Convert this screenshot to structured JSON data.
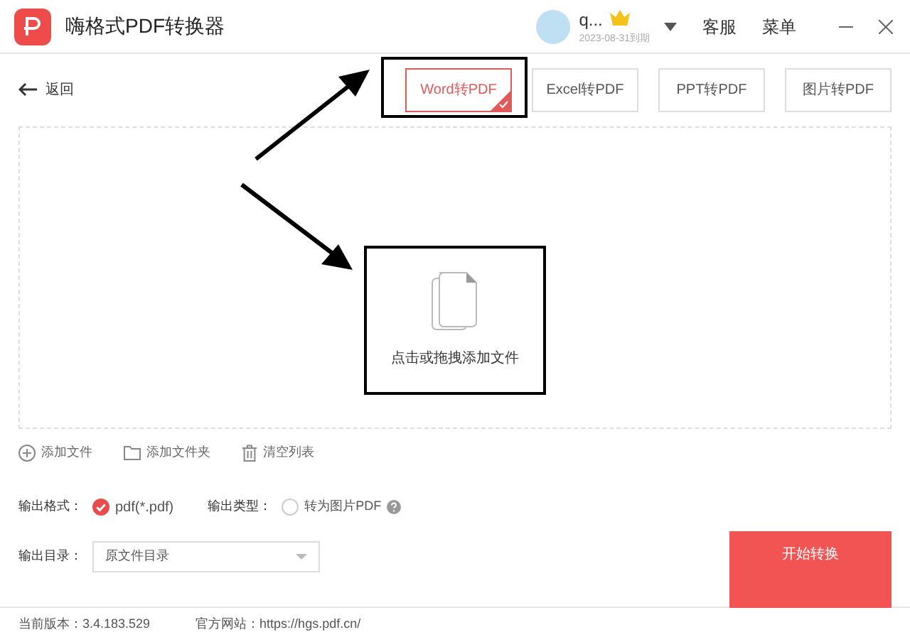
{
  "window": {
    "title": "嗨格式PDF转换器"
  },
  "account": {
    "name": "q...",
    "expiry": "2023-08-31到期"
  },
  "header_links": [
    "客服",
    "菜单"
  ],
  "back": "返回",
  "tabs": [
    {
      "label": "Word转PDF",
      "selected": true
    },
    {
      "label": "Excel转PDF",
      "selected": false
    },
    {
      "label": "PPT转PDF",
      "selected": false
    },
    {
      "label": "图片转PDF",
      "selected": false
    }
  ],
  "dropzone": {
    "hint": "点击或拖拽添加文件"
  },
  "actions": [
    {
      "kind": "add-file",
      "label": "添加文件"
    },
    {
      "kind": "add-folder",
      "label": "添加文件夹"
    },
    {
      "kind": "clear",
      "label": "清空列表"
    }
  ],
  "output_format": {
    "label": "输出格式：",
    "option": {
      "label": "pdf(*.pdf)",
      "checked": true
    }
  },
  "output_type": {
    "label": "输出类型：",
    "option": {
      "label": "转为图片PDF",
      "checked": false
    }
  },
  "output_dir": {
    "label": "输出目录：",
    "value": "原文件目录"
  },
  "start_button": "开始转换",
  "footer": {
    "version": "当前版本：3.4.183.529",
    "website": "官方网站：https://hgs.pdf.cn/"
  }
}
